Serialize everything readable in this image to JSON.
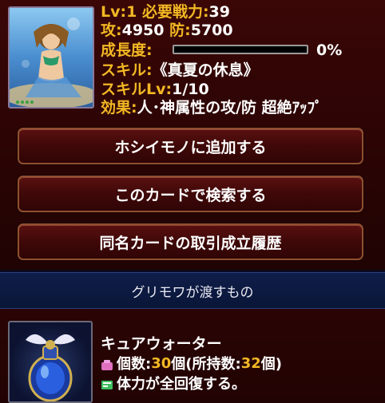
{
  "card": {
    "image_icon": "card-portrait",
    "lv_label": "Lv:1",
    "power_label": "必要戦力:",
    "power_value": "39",
    "atk_label": "攻:",
    "atk_value": "4950",
    "def_label": "防:",
    "def_value": "5700",
    "growth_label": "成長度:",
    "growth_percent": "0%",
    "growth_fraction": 0,
    "skill_label": "スキル:",
    "skill_name": "《真夏の休息》",
    "skill_lv_label": "スキルLv:",
    "skill_lv_value": "1/10",
    "effect_label": "効果:",
    "effect_text": "人･神属性の攻/防 超絶ｱｯﾌﾟ"
  },
  "buttons": {
    "wishlist": "ホシイモノに追加する",
    "search": "このカードで検索する",
    "history": "同名カードの取引成立履歴"
  },
  "section": {
    "title": "グリモワが渡すもの"
  },
  "item": {
    "image_icon": "cure-water-potion",
    "name": "キュアウォーター",
    "count_label": "個数:",
    "count_value": "30",
    "count_unit": "個(所持数:",
    "owned_value": "32",
    "owned_unit": "個)",
    "desc_icon": "book-icon",
    "description": "体力が全回復する。",
    "colors": {
      "gold": "#f2b824",
      "pink_icon": "#e070c0",
      "green_icon": "#40c060"
    }
  }
}
